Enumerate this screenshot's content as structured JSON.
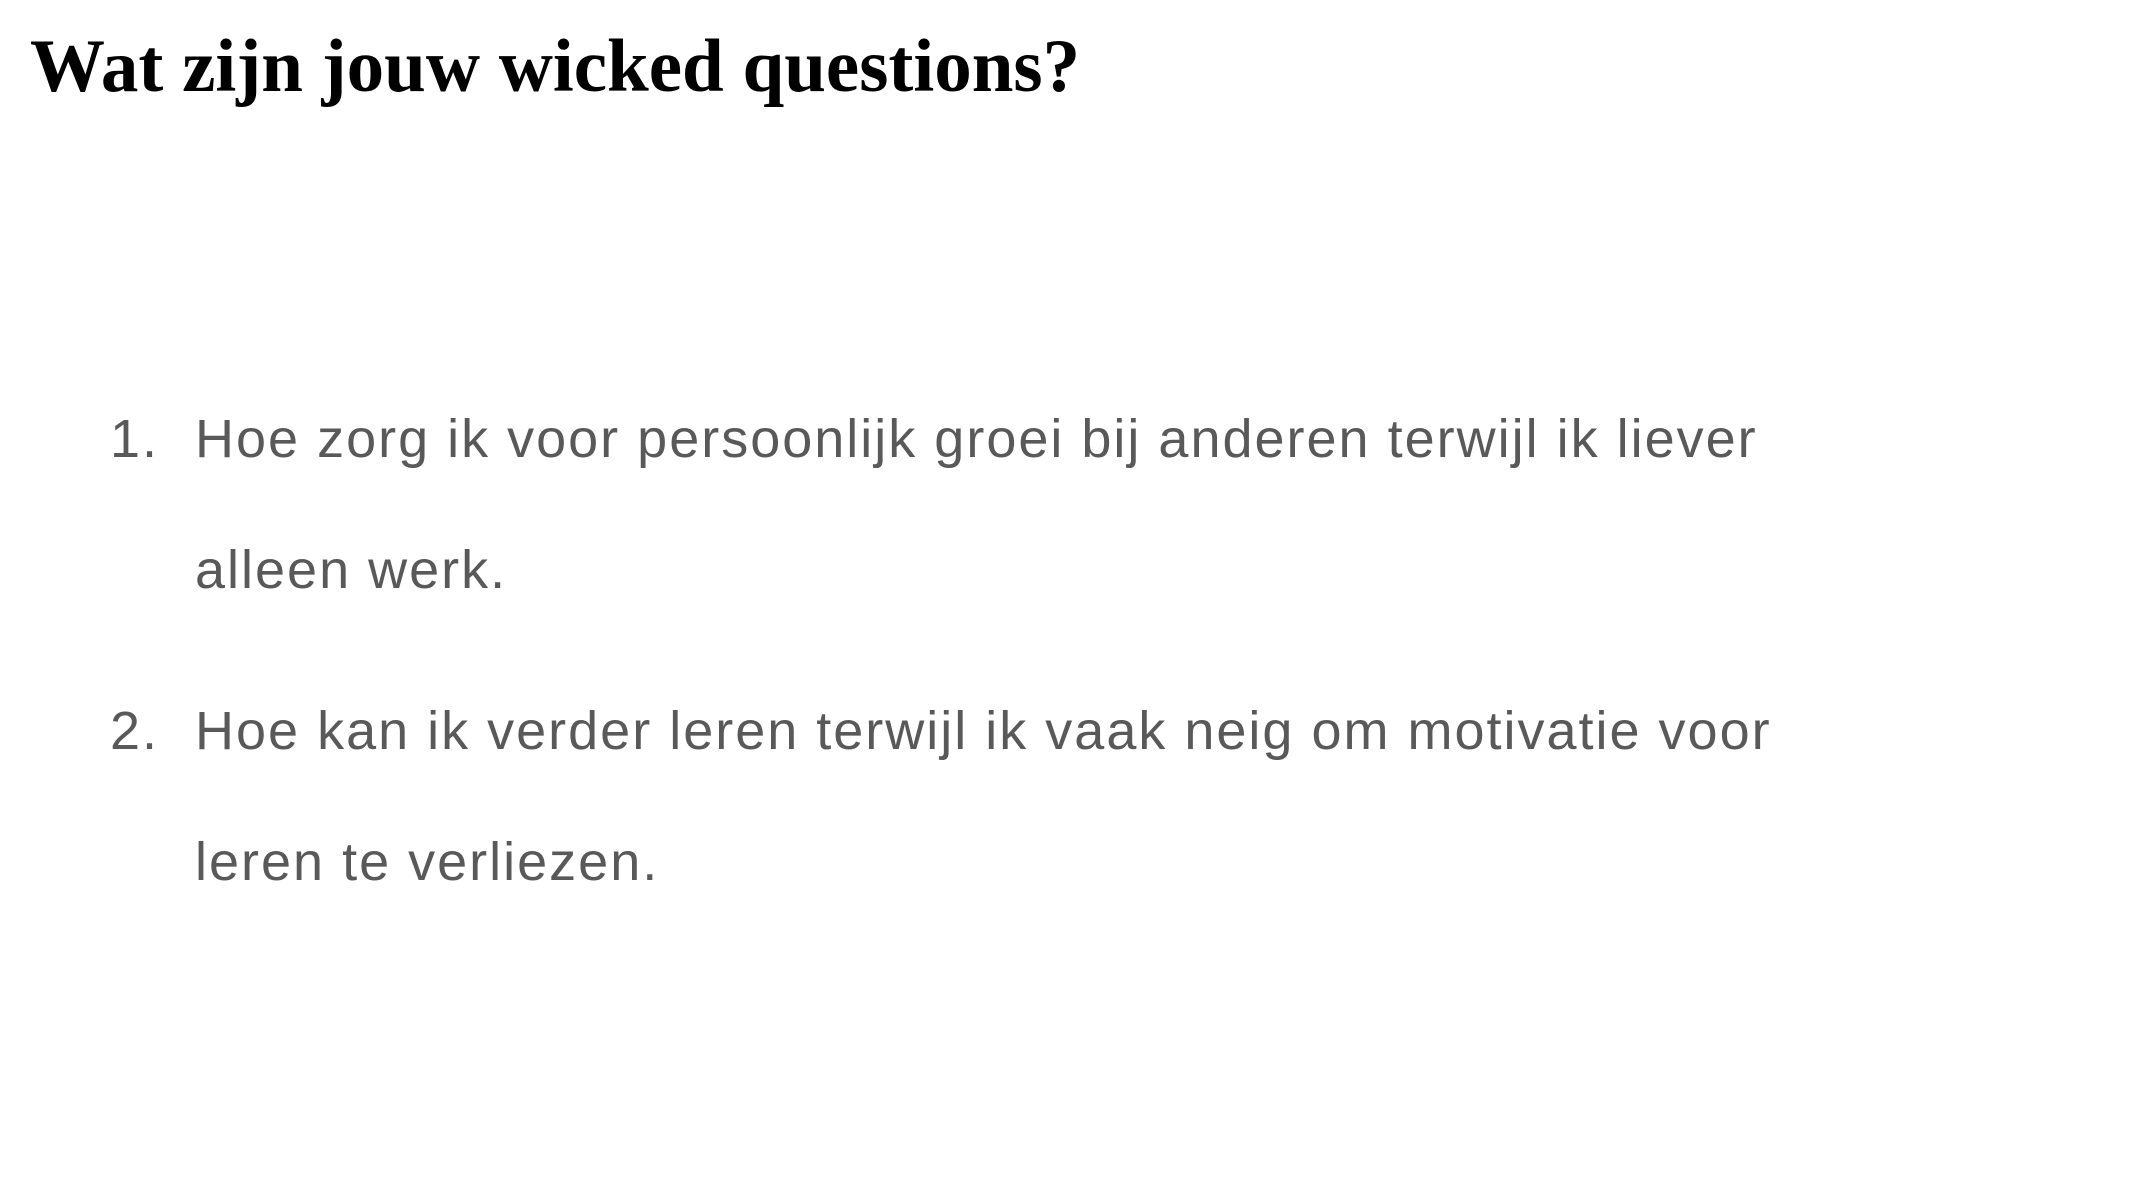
{
  "slide": {
    "title": "Wat zijn jouw wicked questions?",
    "items": [
      {
        "number": "1.",
        "lines": [
          "Hoe zorg ik voor persoonlijk groei bij anderen terwijl ik liever",
          "alleen werk."
        ]
      },
      {
        "number": "2.",
        "lines": [
          "Hoe kan ik verder leren terwijl ik vaak neig om motivatie voor",
          "leren te verliezen."
        ]
      }
    ],
    "colors": {
      "title": "#000000",
      "body": "#595959",
      "background": "#ffffff"
    }
  }
}
